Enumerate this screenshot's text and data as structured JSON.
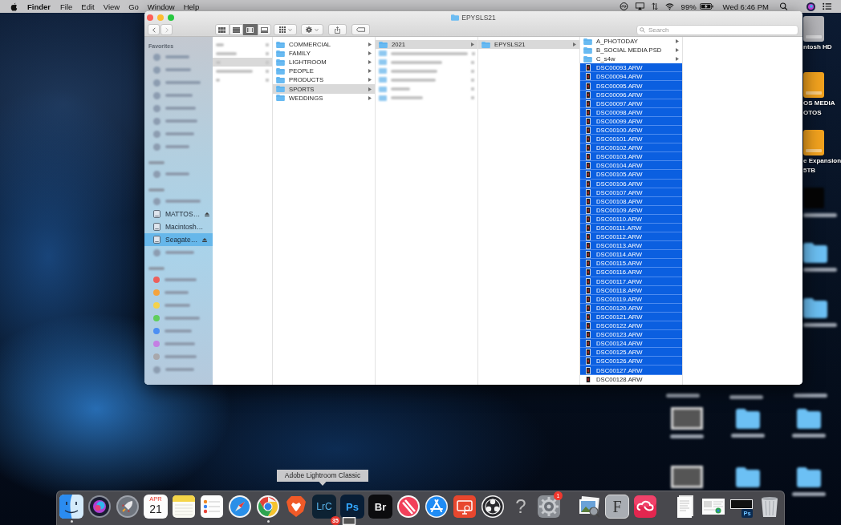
{
  "menu_bar": {
    "app": "Finder",
    "menus": [
      "File",
      "Edit",
      "View",
      "Go",
      "Window",
      "Help"
    ],
    "battery": "99%",
    "clock": "Wed 6:46 PM"
  },
  "window": {
    "title": "EPYSLS21",
    "back_disabled": false,
    "forward_disabled": true,
    "views": [
      {
        "kind": "icons",
        "selected": false
      },
      {
        "kind": "list",
        "selected": false
      },
      {
        "kind": "columns",
        "selected": true
      },
      {
        "kind": "gallery",
        "selected": false
      }
    ],
    "search": {
      "placeholder": "Search"
    }
  },
  "sidebar": {
    "rows": [
      {
        "kind": "heading",
        "label": "Favorites"
      },
      {
        "kind": "blurred",
        "selected": false
      },
      {
        "kind": "blurred",
        "selected": false
      },
      {
        "kind": "blurred",
        "selected": false
      },
      {
        "kind": "blurred",
        "selected": false
      },
      {
        "kind": "blurred",
        "selected": false
      },
      {
        "kind": "blurred",
        "selected": false
      },
      {
        "kind": "blurred",
        "selected": false
      },
      {
        "kind": "blurred",
        "selected": false
      },
      {
        "kind": "blurred-heading"
      },
      {
        "kind": "blurred",
        "selected": false
      },
      {
        "kind": "blurred-heading"
      },
      {
        "kind": "blurred",
        "selected": false
      },
      {
        "kind": "drive",
        "label": "MATTOS…",
        "eject": true,
        "selected": false
      },
      {
        "kind": "drive",
        "label": "Macintosh…",
        "eject": false,
        "selected": false
      },
      {
        "kind": "drive",
        "label": "Seagate…",
        "eject": true,
        "selected": true
      },
      {
        "kind": "blurred",
        "selected": false
      },
      {
        "kind": "blurred-heading"
      },
      {
        "kind": "tag",
        "color": "#ec5f5b",
        "selected": false
      },
      {
        "kind": "tag",
        "color": "#f5a33d",
        "selected": false
      },
      {
        "kind": "tag",
        "color": "#f4d24c",
        "selected": false
      },
      {
        "kind": "tag",
        "color": "#5fce5b",
        "selected": false
      },
      {
        "kind": "tag",
        "color": "#4c8ff3",
        "selected": false
      },
      {
        "kind": "tag",
        "color": "#c47fe3",
        "selected": false
      },
      {
        "kind": "tag",
        "color": "#a8a8ac",
        "selected": false
      },
      {
        "kind": "blurred",
        "selected": false
      }
    ]
  },
  "columns": [
    {
      "rows": [
        {
          "kind": "blurred",
          "selected": false
        },
        {
          "kind": "blurred",
          "selected": false
        },
        {
          "kind": "blurred",
          "selected": true
        },
        {
          "kind": "blurred",
          "selected": false
        },
        {
          "kind": "blurred",
          "selected": false
        }
      ]
    },
    {
      "rows": [
        {
          "kind": "folder",
          "name": "COMMERCIAL",
          "selected": false
        },
        {
          "kind": "folder",
          "name": "FAMILY",
          "selected": false
        },
        {
          "kind": "folder",
          "name": "LIGHTROOM",
          "selected": false
        },
        {
          "kind": "folder",
          "name": "PEOPLE",
          "selected": false
        },
        {
          "kind": "folder",
          "name": "PRODUCTS",
          "selected": false
        },
        {
          "kind": "folder",
          "name": "SPORTS",
          "selected": true
        },
        {
          "kind": "folder",
          "name": "WEDDINGS",
          "selected": false
        }
      ]
    },
    {
      "rows": [
        {
          "kind": "folder",
          "name": "2021",
          "selected": true
        },
        {
          "kind": "blurred",
          "selected": false
        },
        {
          "kind": "blurred",
          "selected": false
        },
        {
          "kind": "blurred",
          "selected": false
        },
        {
          "kind": "blurred",
          "selected": false
        },
        {
          "kind": "blurred",
          "selected": false
        },
        {
          "kind": "blurred",
          "selected": false
        }
      ]
    },
    {
      "rows": [
        {
          "kind": "folder",
          "name": "EPYSLS21",
          "selected": true
        }
      ]
    },
    {
      "rows": [
        {
          "kind": "folder",
          "name": "A_PHOTODAY",
          "selected": false
        },
        {
          "kind": "folder",
          "name": "B_SOCIAL MEDIA PSD",
          "selected": false
        },
        {
          "kind": "folder",
          "name": "C_s4w",
          "selected": false
        },
        {
          "kind": "file",
          "name": "DSC00093.ARW",
          "selected": true
        },
        {
          "kind": "file",
          "name": "DSC00094.ARW",
          "selected": true
        },
        {
          "kind": "file",
          "name": "DSC00095.ARW",
          "selected": true
        },
        {
          "kind": "file",
          "name": "DSC00096.ARW",
          "selected": true
        },
        {
          "kind": "file",
          "name": "DSC00097.ARW",
          "selected": true
        },
        {
          "kind": "file",
          "name": "DSC00098.ARW",
          "selected": true
        },
        {
          "kind": "file",
          "name": "DSC00099.ARW",
          "selected": true
        },
        {
          "kind": "file",
          "name": "DSC00100.ARW",
          "selected": true
        },
        {
          "kind": "file",
          "name": "DSC00101.ARW",
          "selected": true
        },
        {
          "kind": "file",
          "name": "DSC00102.ARW",
          "selected": true
        },
        {
          "kind": "file",
          "name": "DSC00103.ARW",
          "selected": true
        },
        {
          "kind": "file",
          "name": "DSC00104.ARW",
          "selected": true
        },
        {
          "kind": "file",
          "name": "DSC00105.ARW",
          "selected": true
        },
        {
          "kind": "file",
          "name": "DSC00106.ARW",
          "selected": true
        },
        {
          "kind": "file",
          "name": "DSC00107.ARW",
          "selected": true
        },
        {
          "kind": "file",
          "name": "DSC00108.ARW",
          "selected": true
        },
        {
          "kind": "file",
          "name": "DSC00109.ARW",
          "selected": true
        },
        {
          "kind": "file",
          "name": "DSC00110.ARW",
          "selected": true
        },
        {
          "kind": "file",
          "name": "DSC00111.ARW",
          "selected": true
        },
        {
          "kind": "file",
          "name": "DSC00112.ARW",
          "selected": true
        },
        {
          "kind": "file",
          "name": "DSC00113.ARW",
          "selected": true
        },
        {
          "kind": "file",
          "name": "DSC00114.ARW",
          "selected": true
        },
        {
          "kind": "file",
          "name": "DSC00115.ARW",
          "selected": true
        },
        {
          "kind": "file",
          "name": "DSC00116.ARW",
          "selected": true
        },
        {
          "kind": "file",
          "name": "DSC00117.ARW",
          "selected": true
        },
        {
          "kind": "file",
          "name": "DSC00118.ARW",
          "selected": true
        },
        {
          "kind": "file",
          "name": "DSC00119.ARW",
          "selected": true
        },
        {
          "kind": "file",
          "name": "DSC00120.ARW",
          "selected": true
        },
        {
          "kind": "file",
          "name": "DSC00121.ARW",
          "selected": true
        },
        {
          "kind": "file",
          "name": "DSC00122.ARW",
          "selected": true
        },
        {
          "kind": "file",
          "name": "DSC00123.ARW",
          "selected": true
        },
        {
          "kind": "file",
          "name": "DSC00124.ARW",
          "selected": true
        },
        {
          "kind": "file",
          "name": "DSC00125.ARW",
          "selected": true
        },
        {
          "kind": "file",
          "name": "DSC00126.ARW",
          "selected": true
        },
        {
          "kind": "file",
          "name": "DSC00127.ARW",
          "selected": true
        },
        {
          "kind": "file",
          "name": "DSC00128.ARW",
          "selected": false
        }
      ]
    }
  ],
  "desktop": {
    "icons": [
      {
        "kind": "drive",
        "color": "#b4b4b8",
        "label_lines": [
          "ntosh HD"
        ]
      },
      {
        "kind": "drive",
        "color": "#f2a21e",
        "label_lines": [
          "OS MEDIA",
          "OTOS"
        ]
      },
      {
        "kind": "drive",
        "color": "#f2a21e",
        "label_lines": [
          "e Expansion",
          "5TB"
        ]
      },
      {
        "kind": "dark-file",
        "label_blurred": true
      },
      {
        "kind": "folder",
        "label_blurred": true
      },
      {
        "kind": "folder",
        "label_blurred": true
      },
      {
        "kind": "label-only",
        "label_blurred": true
      },
      {
        "kind": "label-only",
        "label_blurred": true
      },
      {
        "kind": "label-only",
        "label_blurred": true
      },
      {
        "kind": "screenshot",
        "label_blurred": true
      },
      {
        "kind": "folder",
        "label_blurred": true
      },
      {
        "kind": "folder",
        "label_blurred": true
      },
      {
        "kind": "screenshot"
      },
      {
        "kind": "folder"
      },
      {
        "kind": "folder",
        "label_blurred": true
      }
    ]
  },
  "dock": {
    "tooltip": "Adobe Lightroom Classic",
    "drag_count": "35",
    "apps": [
      {
        "kind": "finder",
        "running": true
      },
      {
        "kind": "siri",
        "running": false
      },
      {
        "kind": "launchpad",
        "running": false
      },
      {
        "kind": "calendar",
        "month": "APR",
        "day": "21",
        "running": false
      },
      {
        "kind": "notes",
        "running": false
      },
      {
        "kind": "reminders",
        "running": false
      },
      {
        "kind": "safari",
        "running": false
      },
      {
        "kind": "chrome",
        "running": true
      },
      {
        "kind": "brave",
        "running": false
      },
      {
        "kind": "lightroom",
        "text": "LrC",
        "running": false
      },
      {
        "kind": "photoshop",
        "text": "Ps",
        "running": false
      },
      {
        "kind": "bridge",
        "text": "Br",
        "running": false
      },
      {
        "kind": "news",
        "running": false
      },
      {
        "kind": "appstore",
        "running": false
      },
      {
        "kind": "screenshare",
        "running": false
      },
      {
        "kind": "obs",
        "running": false
      },
      {
        "kind": "help",
        "text": "?",
        "running": false
      },
      {
        "kind": "preferences",
        "badge": "1",
        "running": false
      },
      {
        "kind": "separator"
      },
      {
        "kind": "preview",
        "running": false
      },
      {
        "kind": "fontbook",
        "text": "F",
        "running": false
      },
      {
        "kind": "creative-cloud",
        "running": false
      },
      {
        "kind": "separator"
      },
      {
        "kind": "doc-stack",
        "running": false
      },
      {
        "kind": "screenshot-stack",
        "running": false
      },
      {
        "kind": "ps-stack",
        "text": "Ps",
        "running": false
      },
      {
        "kind": "trash",
        "running": false
      }
    ]
  }
}
